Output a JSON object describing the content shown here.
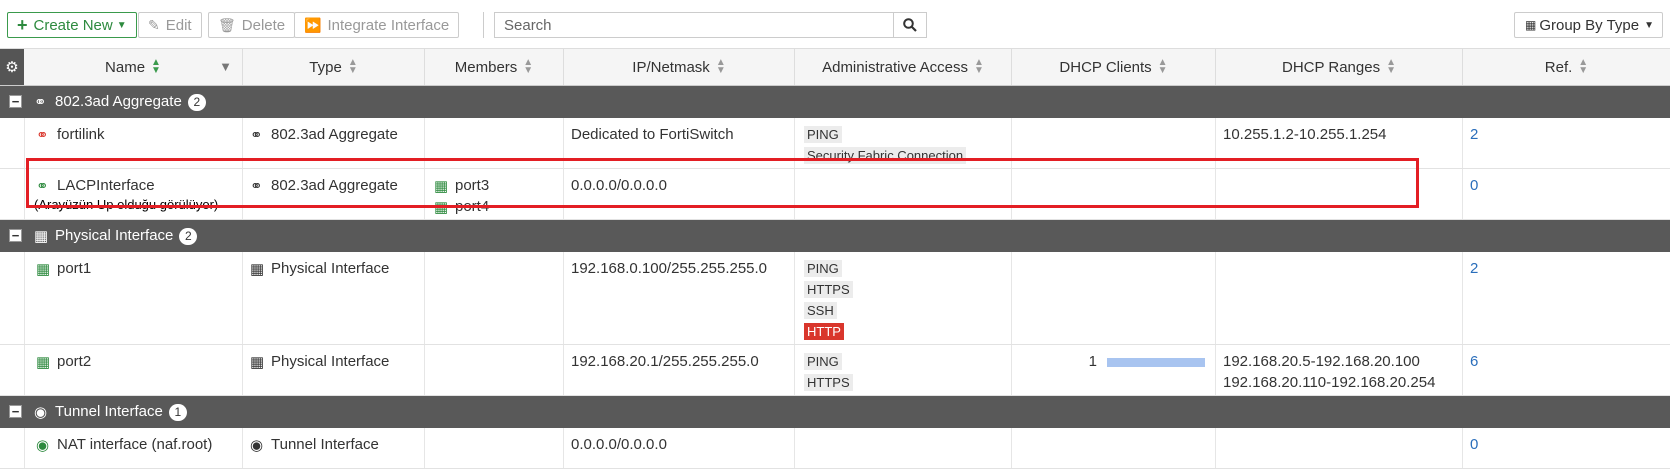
{
  "toolbar": {
    "create_new": "Create New",
    "edit": "Edit",
    "delete": "Delete",
    "integrate": "Integrate Interface",
    "search_placeholder": "Search",
    "group_by": "Group By Type"
  },
  "columns": [
    "Name",
    "Type",
    "Members",
    "IP/Netmask",
    "Administrative Access",
    "DHCP Clients",
    "DHCP Ranges",
    "Ref."
  ],
  "groups": [
    {
      "label": "802.3ad Aggregate",
      "count": "2",
      "rows": [
        {
          "name": "fortilink",
          "type": "802.3ad Aggregate",
          "members": [],
          "ip": "Dedicated to FortiSwitch",
          "access": [
            "PING",
            "Security Fabric Connection"
          ],
          "dhcp_clients": "",
          "dhcp_ranges": [
            "10.255.1.2-10.255.1.254"
          ],
          "ref": "2"
        },
        {
          "name": "LACPInterface",
          "note": "(Arayüzün Up olduğu görülüyor)",
          "type": "802.3ad Aggregate",
          "members": [
            "port3",
            "port4"
          ],
          "ip": "0.0.0.0/0.0.0.0",
          "access": [],
          "dhcp_clients": "",
          "dhcp_ranges": [],
          "ref": "0"
        }
      ]
    },
    {
      "label": "Physical Interface",
      "count": "2",
      "rows": [
        {
          "name": "port1",
          "type": "Physical Interface",
          "members": [],
          "ip": "192.168.0.100/255.255.255.0",
          "access": [
            "PING",
            "HTTPS",
            "SSH",
            "HTTP"
          ],
          "dhcp_clients": "",
          "dhcp_ranges": [],
          "ref": "2"
        },
        {
          "name": "port2",
          "type": "Physical Interface",
          "members": [],
          "ip": "192.168.20.1/255.255.255.0",
          "access": [
            "PING",
            "HTTPS"
          ],
          "dhcp_clients": "1",
          "dhcp_ranges": [
            "192.168.20.5-192.168.20.100",
            "192.168.20.110-192.168.20.254"
          ],
          "ref": "6"
        }
      ]
    },
    {
      "label": "Tunnel Interface",
      "count": "1",
      "rows": [
        {
          "name": "NAT interface (naf.root)",
          "type": "Tunnel Interface",
          "members": [],
          "ip": "0.0.0.0/0.0.0.0",
          "access": [],
          "dhcp_clients": "",
          "dhcp_ranges": [],
          "ref": "0"
        }
      ]
    }
  ],
  "colors": {
    "accent_green": "#3a9a4c",
    "header_group": "#595959",
    "highlight": "#e31e24",
    "http_warning": "#d9362c",
    "link": "#2a6ebb"
  }
}
